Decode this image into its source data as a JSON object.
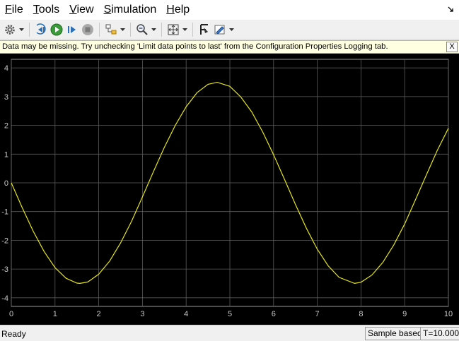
{
  "menu": {
    "items": [
      {
        "mnemonic": "F",
        "rest": "ile"
      },
      {
        "mnemonic": "T",
        "rest": "ools"
      },
      {
        "mnemonic": "V",
        "rest": "iew"
      },
      {
        "mnemonic": "S",
        "rest": "imulation"
      },
      {
        "mnemonic": "H",
        "rest": "elp"
      }
    ]
  },
  "toolbar": {
    "icons": [
      "settings-icon",
      "step-back-icon",
      "run-icon",
      "step-forward-icon",
      "stop-icon",
      "highlight-block-icon",
      "zoom-icon",
      "fit-to-view-icon",
      "cursor-measurements-icon",
      "style-icon"
    ]
  },
  "infobar": {
    "message": "Data may be missing.  Try unchecking 'Limit data points to last' from the Configuration Properties Logging tab.",
    "close_label": "X"
  },
  "chart_data": {
    "type": "line",
    "title": "",
    "xlabel": "",
    "ylabel": "",
    "xlim": [
      0,
      10
    ],
    "ylim": [
      -4.3,
      4.3
    ],
    "xticks": [
      "0",
      "1",
      "2",
      "3",
      "4",
      "5",
      "6",
      "7",
      "8",
      "9",
      "10"
    ],
    "yticks": [
      "4",
      "3",
      "2",
      "1",
      "0",
      "-1",
      "-2",
      "-3",
      "-4"
    ],
    "grid": true,
    "background": "#000000",
    "line_color": "#e6e619",
    "series": [
      {
        "x": [
          0,
          0.25,
          0.5,
          0.75,
          1,
          1.25,
          1.5,
          1.571,
          1.75,
          2,
          2.25,
          2.5,
          2.75,
          3,
          3.25,
          3.5,
          3.75,
          4,
          4.25,
          4.5,
          4.712,
          5,
          5.25,
          5.5,
          5.75,
          6,
          6.25,
          6.5,
          6.75,
          7,
          7.25,
          7.5,
          7.854,
          8,
          8.25,
          8.5,
          8.75,
          9,
          9.25,
          9.5,
          9.75,
          10
        ],
        "values": [
          0,
          -0.87,
          -1.68,
          -2.39,
          -2.95,
          -3.32,
          -3.49,
          -3.5,
          -3.45,
          -3.18,
          -2.72,
          -2.09,
          -1.34,
          -0.49,
          0.38,
          1.23,
          2.0,
          2.65,
          3.14,
          3.43,
          3.5,
          3.36,
          2.99,
          2.47,
          1.78,
          0.98,
          0.12,
          -0.75,
          -1.58,
          -2.31,
          -2.89,
          -3.29,
          -3.5,
          -3.46,
          -3.21,
          -2.77,
          -2.16,
          -1.43,
          -0.58,
          0.29,
          1.14,
          1.9
        ]
      }
    ]
  },
  "status": {
    "left": "Ready",
    "sample": "Sample based",
    "time": "T=10.000"
  }
}
